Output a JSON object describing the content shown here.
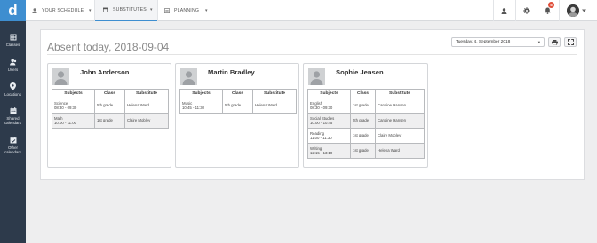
{
  "app": {
    "logo_letter": "d"
  },
  "sidebar": {
    "items": [
      {
        "label": "Classes",
        "icon": "classes-icon"
      },
      {
        "label": "Users",
        "icon": "users-icon"
      },
      {
        "label": "Locations",
        "icon": "location-pin-icon"
      },
      {
        "label": "Shared calendars",
        "icon": "calendar-icon"
      },
      {
        "label": "Other calendars",
        "icon": "calendar-check-icon"
      }
    ]
  },
  "topbar": {
    "tabs": [
      {
        "label": "YOUR SCHEDULE",
        "icon": "person-icon",
        "active": false
      },
      {
        "label": "SUBSTITUTES",
        "icon": "calendar-icon",
        "active": true
      },
      {
        "label": "PLANNING",
        "icon": "planning-icon",
        "active": false
      }
    ],
    "notification_count": "5",
    "icons": [
      "user-icon",
      "gear-icon",
      "bell-icon",
      "avatar"
    ]
  },
  "page": {
    "title": "Absent today, 2018-09-04",
    "date_value": "Tuesday, 4. September 2018"
  },
  "table_headers": {
    "subjects": "Subjects",
    "class": "Class",
    "substitute": "Substitute"
  },
  "absences": [
    {
      "name": "John Anderson",
      "rows": [
        {
          "subject": "Science",
          "time": "08:30 - 09:30",
          "class": "5th grade",
          "substitute": "Helena Ward"
        },
        {
          "subject": "Math",
          "time": "10:00 - 11:00",
          "class": "1st grade",
          "substitute": "Claire Mobley"
        }
      ]
    },
    {
      "name": "Martin Bradley",
      "rows": [
        {
          "subject": "Music",
          "time": "10:45 - 11:30",
          "class": "5th grade",
          "substitute": "Helena Ward"
        }
      ]
    },
    {
      "name": "Sophie Jensen",
      "rows": [
        {
          "subject": "English",
          "time": "08:30 - 09:30",
          "class": "1st grade",
          "substitute": "Caroline Hansen"
        },
        {
          "subject": "Social Studies",
          "time": "10:00 - 10:45",
          "class": "5th grade",
          "substitute": "Caroline Hansen"
        },
        {
          "subject": "Reading",
          "time": "11:00 - 11:30",
          "class": "1st grade",
          "substitute": "Claire Mobley"
        },
        {
          "subject": "Writing",
          "time": "12:15 - 13:10",
          "class": "1st grade",
          "substitute": "Helena Ward"
        }
      ]
    }
  ],
  "colors": {
    "sidebar": "#2d3a4b",
    "brand": "#3e8ed0",
    "badge": "#e04e3a"
  }
}
